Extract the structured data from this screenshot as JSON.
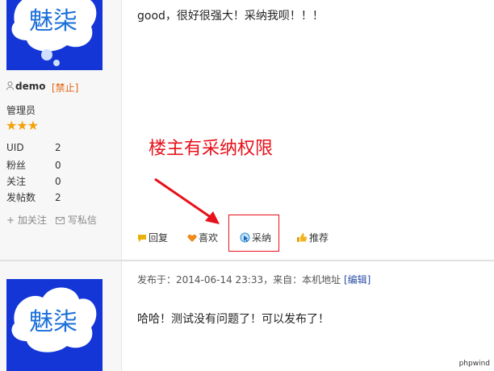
{
  "post1": {
    "avatar_text": "魅柒",
    "username": "demo",
    "ban_label": "[禁止]",
    "role": "管理员",
    "stars": "★★★",
    "stats": [
      {
        "label": "UID",
        "value": "2"
      },
      {
        "label": "粉丝",
        "value": "0"
      },
      {
        "label": "关注",
        "value": "0"
      },
      {
        "label": "发帖数",
        "value": "2"
      }
    ],
    "follow_label": "+ 加关注",
    "message_label": "写私信",
    "content": "good，很好很强大！采纳我呗！！！",
    "annotation": "楼主有采纳权限",
    "actions": {
      "reply": "回复",
      "like": "喜欢",
      "adopt": "采纳",
      "recommend": "推荐"
    }
  },
  "post2": {
    "avatar_text": "魅柒",
    "meta_prefix": "发布于：2014-06-14 23:33，来自：本机地址 ",
    "edit_label": "[编辑]",
    "content": "哈哈！测试没有问题了！可以发布了！"
  },
  "watermark": "phpwind",
  "colors": {
    "avatar_bg": "#1436d6",
    "annotation_red": "#e8101a",
    "ban_orange": "#e2620c",
    "star_gold": "#f4a20b",
    "link_blue": "#2b4da3"
  }
}
